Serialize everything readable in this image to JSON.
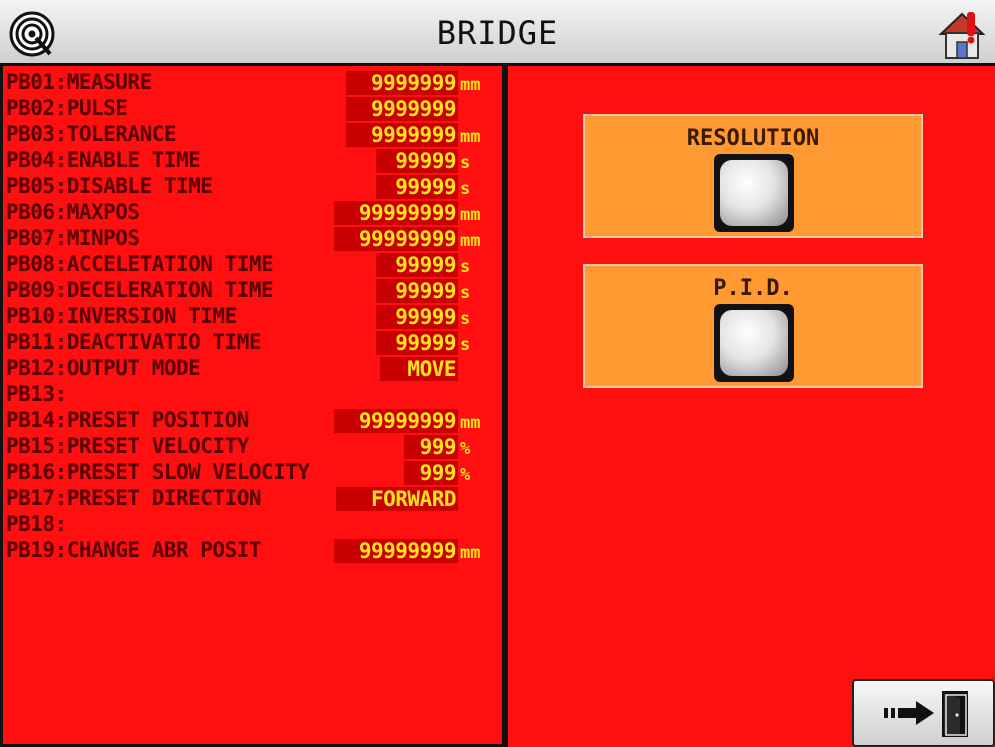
{
  "header": {
    "title": "BRIDGE"
  },
  "params": [
    {
      "label": "PB01:MEASURE",
      "value": "9999999",
      "unit": "mm"
    },
    {
      "label": "PB02:PULSE",
      "value": "9999999",
      "unit": ""
    },
    {
      "label": "PB03:TOLERANCE",
      "value": "9999999",
      "unit": "mm"
    },
    {
      "label": "PB04:ENABLE TIME",
      "value": "99999",
      "unit": "s"
    },
    {
      "label": "PB05:DISABLE TIME",
      "value": "99999",
      "unit": "s"
    },
    {
      "label": "PB06:MAXPOS",
      "value": "99999999",
      "unit": "mm"
    },
    {
      "label": "PB07:MINPOS",
      "value": "99999999",
      "unit": "mm"
    },
    {
      "label": "PB08:ACCELETATION TIME",
      "value": "99999",
      "unit": "s"
    },
    {
      "label": "PB09:DECELERATION TIME",
      "value": "99999",
      "unit": "s"
    },
    {
      "label": "PB10:INVERSION TIME",
      "value": "99999",
      "unit": "s"
    },
    {
      "label": "PB11:DEACTIVATIO TIME",
      "value": "99999",
      "unit": "s"
    },
    {
      "label": "PB12:OUTPUT MODE",
      "value": "MOVE",
      "unit": ""
    },
    {
      "label": "PB13:",
      "value": "",
      "unit": ""
    },
    {
      "label": "PB14:PRESET POSITION",
      "value": "99999999",
      "unit": "mm"
    },
    {
      "label": "PB15:PRESET VELOCITY",
      "value": "999",
      "unit": "%"
    },
    {
      "label": "PB16:PRESET SLOW VELOCITY",
      "value": "999",
      "unit": "%"
    },
    {
      "label": "PB17:PRESET DIRECTION",
      "value": "FORWARD",
      "unit": ""
    },
    {
      "label": "PB18:",
      "value": "",
      "unit": ""
    },
    {
      "label": "PB19:CHANGE ABR POSIT",
      "value": "99999999",
      "unit": "mm"
    }
  ],
  "functions": {
    "resolution": {
      "label": "RESOLUTION"
    },
    "pid": {
      "label": "P.I.D."
    }
  },
  "icons": {
    "logo": "target-logo-icon",
    "home": "home-alert-icon",
    "exit": "exit-door-icon"
  },
  "colors": {
    "background": "#ff0f0f",
    "label": "#5a0000",
    "value": "#ffe21a",
    "value_bg": "#c80000",
    "function_box": "#ff9a33"
  }
}
